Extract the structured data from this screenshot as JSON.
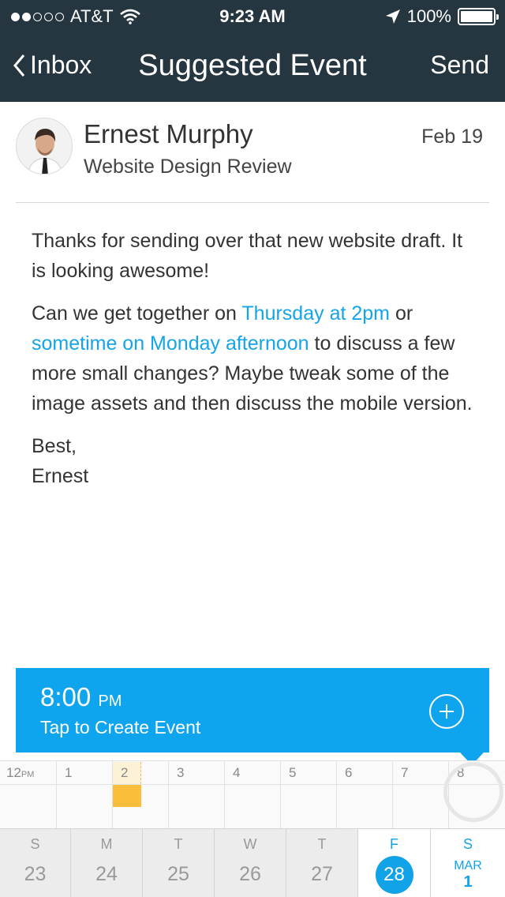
{
  "status_bar": {
    "carrier": "AT&T",
    "time": "9:23 AM",
    "battery": "100%",
    "signal_bars_filled": 2,
    "signal_bars_total": 5
  },
  "nav": {
    "back_label": "Inbox",
    "title": "Suggested Event",
    "send_label": "Send"
  },
  "message": {
    "sender": "Ernest Murphy",
    "subject": "Website Design Review",
    "date": "Feb 19",
    "para1": "Thanks for sending over that new website draft. It is looking awesome!",
    "para2_prefix": "Can we get together on ",
    "link1": "Thursday at 2pm",
    "para2_mid": " or ",
    "link2": "sometime on Monday afternoon",
    "para2_suffix": " to discuss a few more small changes? Maybe tweak some of the image assets and then discuss the mobile version.",
    "signoff": "Best,",
    "signature": "Ernest"
  },
  "event_card": {
    "time": "8:00",
    "ampm": "PM",
    "hint": "Tap to Create Event",
    "color": "#0fa5ee"
  },
  "timeline": {
    "hours": [
      {
        "label": "12",
        "suffix": "PM"
      },
      {
        "label": "1",
        "suffix": ""
      },
      {
        "label": "2",
        "suffix": ""
      },
      {
        "label": "3",
        "suffix": ""
      },
      {
        "label": "4",
        "suffix": ""
      },
      {
        "label": "5",
        "suffix": ""
      },
      {
        "label": "6",
        "suffix": ""
      },
      {
        "label": "7",
        "suffix": ""
      },
      {
        "label": "8",
        "suffix": ""
      }
    ],
    "busy_color": "#fbbd3c"
  },
  "days": [
    {
      "letter": "S",
      "num": "23"
    },
    {
      "letter": "M",
      "num": "24"
    },
    {
      "letter": "T",
      "num": "25"
    },
    {
      "letter": "W",
      "num": "26"
    },
    {
      "letter": "T",
      "num": "27"
    },
    {
      "letter": "F",
      "num": "28"
    },
    {
      "letter": "S",
      "month": "MAR",
      "num": "1"
    }
  ],
  "colors": {
    "nav_bg": "#253640",
    "accent": "#12a2e8"
  }
}
